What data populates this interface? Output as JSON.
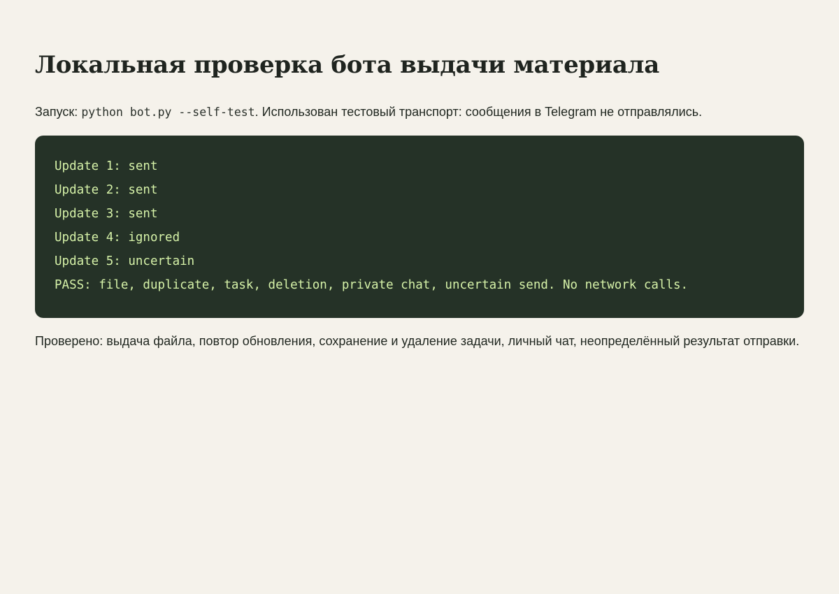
{
  "title": "Локальная проверка бота выдачи материала",
  "intro": {
    "prefix": "Запуск: ",
    "command": "python bot.py --self-test",
    "suffix": ". Использован тестовый транспорт: сообщения в Telegram не отправлялись."
  },
  "console": {
    "lines": [
      "Update 1: sent",
      "Update 2: sent",
      "Update 3: sent",
      "Update 4: ignored",
      "Update 5: uncertain",
      "PASS: file, duplicate, task, deletion, private chat, uncertain send. No network calls."
    ]
  },
  "summary": "Проверено: выдача файла, повтор обновления, сохранение и удаление задачи, личный чат, неопределённый результат отправки.",
  "colors": {
    "background": "#f5f2eb",
    "console_background": "#253227",
    "console_text": "#d6f2a8",
    "text": "#1f261f"
  }
}
